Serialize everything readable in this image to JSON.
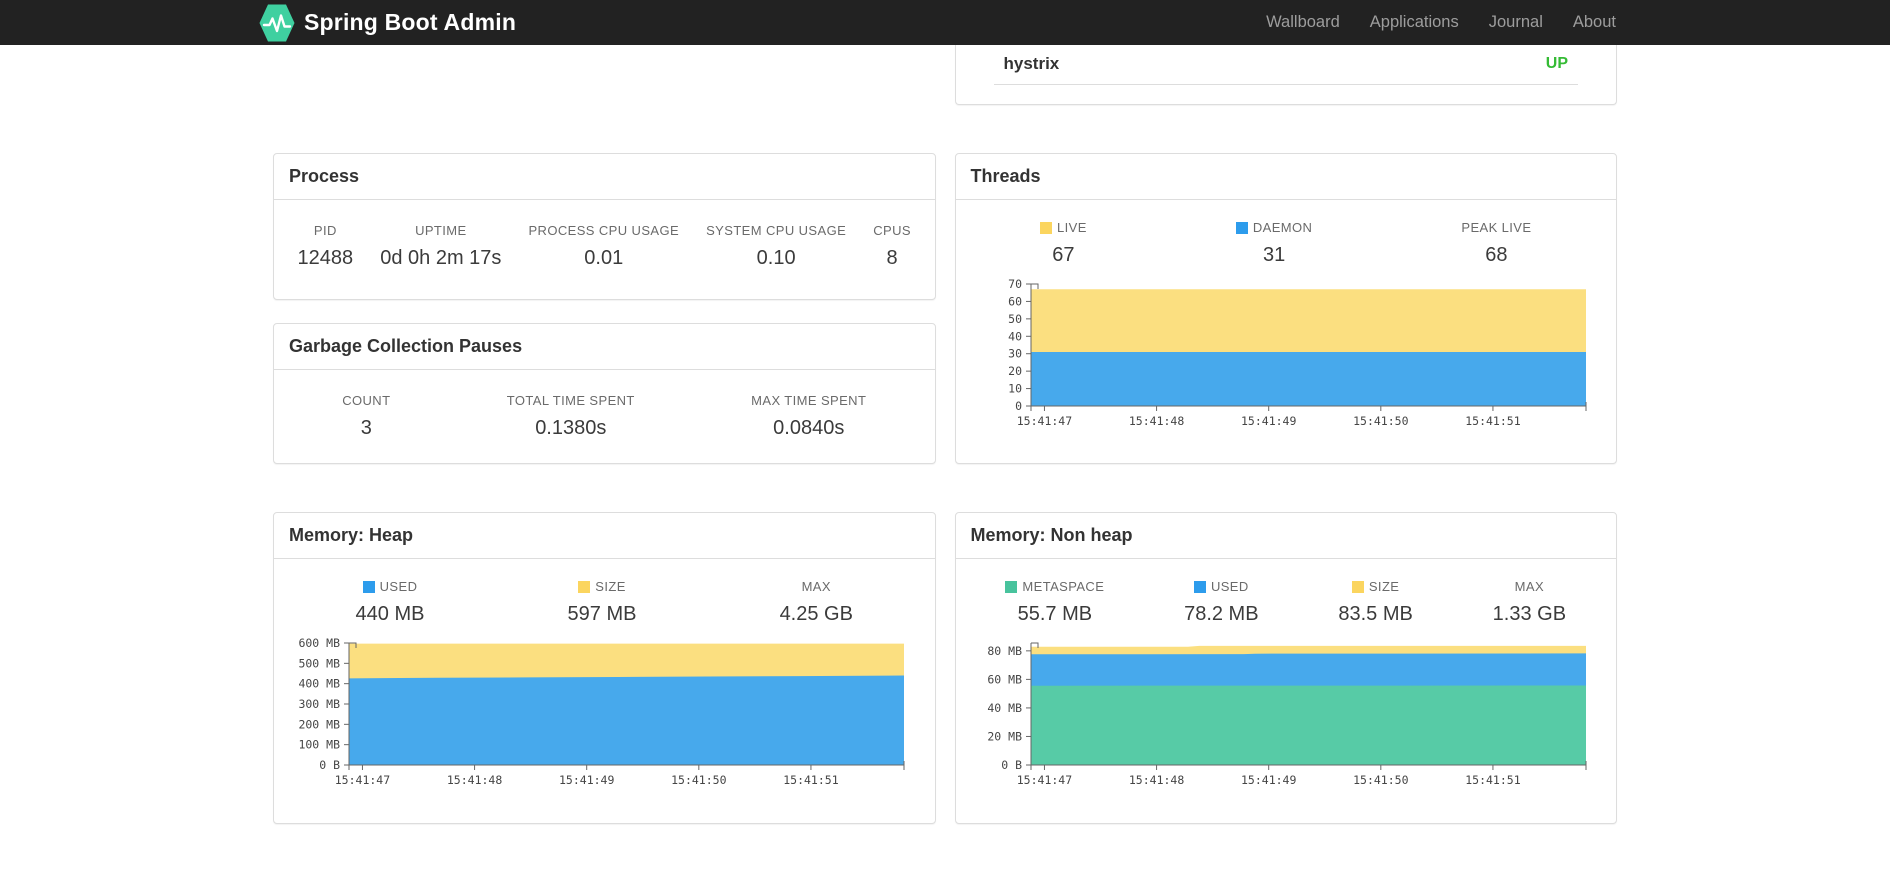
{
  "navbar": {
    "brand": "Spring Boot Admin",
    "logo_color": "#3fd0a0",
    "items": [
      {
        "label": "Wallboard"
      },
      {
        "label": "Applications"
      },
      {
        "label": "Journal"
      },
      {
        "label": "About"
      }
    ]
  },
  "status_panel": {
    "application": "hystrix",
    "status": "UP",
    "status_color": "#35bb35"
  },
  "process": {
    "title": "Process",
    "metrics": [
      {
        "label": "PID",
        "value": "12488"
      },
      {
        "label": "UPTIME",
        "value": "0d 0h 2m 17s"
      },
      {
        "label": "PROCESS CPU USAGE",
        "value": "0.01"
      },
      {
        "label": "SYSTEM CPU USAGE",
        "value": "0.10"
      },
      {
        "label": "CPUS",
        "value": "8"
      }
    ]
  },
  "gc": {
    "title": "Garbage Collection Pauses",
    "metrics": [
      {
        "label": "COUNT",
        "value": "3"
      },
      {
        "label": "TOTAL TIME SPENT",
        "value": "0.1380s"
      },
      {
        "label": "MAX TIME SPENT",
        "value": "0.0840s"
      }
    ]
  },
  "threads": {
    "title": "Threads",
    "metrics": [
      {
        "label": "LIVE",
        "value": "67",
        "swatch": "#fbd55f"
      },
      {
        "label": "DAEMON",
        "value": "31",
        "swatch": "#2d9cec"
      },
      {
        "label": "PEAK LIVE",
        "value": "68"
      }
    ]
  },
  "heap": {
    "title": "Memory: Heap",
    "metrics": [
      {
        "label": "USED",
        "value": "440 MB",
        "swatch": "#2d9cec"
      },
      {
        "label": "SIZE",
        "value": "597 MB",
        "swatch": "#fbd55f"
      },
      {
        "label": "MAX",
        "value": "4.25 GB"
      }
    ]
  },
  "nonheap": {
    "title": "Memory: Non heap",
    "metrics": [
      {
        "label": "METASPACE",
        "value": "55.7 MB",
        "swatch": "#48c39d"
      },
      {
        "label": "USED",
        "value": "78.2 MB",
        "swatch": "#2d9cec"
      },
      {
        "label": "SIZE",
        "value": "83.5 MB",
        "swatch": "#fbd55f"
      },
      {
        "label": "MAX",
        "value": "1.33 GB"
      }
    ]
  },
  "chart_data": [
    {
      "id": "threads",
      "type": "area",
      "title": "Threads",
      "x_ticks": [
        "15:41:47",
        "15:41:48",
        "15:41:49",
        "15:41:50",
        "15:41:51"
      ],
      "x_domain": [
        0,
        4.95
      ],
      "x_tick_offset": 0.12,
      "y_max": 70,
      "y_ticks": [
        {
          "v": 0,
          "label": "0"
        },
        {
          "v": 10,
          "label": "10"
        },
        {
          "v": 20,
          "label": "20"
        },
        {
          "v": 30,
          "label": "30"
        },
        {
          "v": 40,
          "label": "40"
        },
        {
          "v": 50,
          "label": "50"
        },
        {
          "v": 60,
          "label": "60"
        },
        {
          "v": 70,
          "label": "70"
        }
      ],
      "series": [
        {
          "name": "LIVE",
          "color": "#fbdf80",
          "points": [
            [
              0,
              67
            ],
            [
              4.95,
              67
            ]
          ]
        },
        {
          "name": "DAEMON",
          "color": "#47a9ec",
          "points": [
            [
              0,
              31
            ],
            [
              4.95,
              31
            ]
          ]
        }
      ],
      "legend_position": "top",
      "grid": false
    },
    {
      "id": "heap",
      "type": "area",
      "title": "Memory: Heap",
      "x_ticks": [
        "15:41:47",
        "15:41:48",
        "15:41:49",
        "15:41:50",
        "15:41:51"
      ],
      "x_domain": [
        0,
        4.95
      ],
      "x_tick_offset": 0.12,
      "y_max": 600,
      "y_unit": "MB",
      "y_ticks": [
        {
          "v": 0,
          "label": "0 B"
        },
        {
          "v": 100,
          "label": "100 MB"
        },
        {
          "v": 200,
          "label": "200 MB"
        },
        {
          "v": 300,
          "label": "300 MB"
        },
        {
          "v": 400,
          "label": "400 MB"
        },
        {
          "v": 500,
          "label": "500 MB"
        },
        {
          "v": 600,
          "label": "600 MB"
        }
      ],
      "series": [
        {
          "name": "SIZE",
          "color": "#fbdf80",
          "points": [
            [
              0,
              597
            ],
            [
              4.95,
              597
            ]
          ]
        },
        {
          "name": "USED",
          "color": "#47a9ec",
          "points": [
            [
              0,
              426
            ],
            [
              0.8,
              429
            ],
            [
              1.6,
              431
            ],
            [
              2.4,
              433
            ],
            [
              3.2,
              435
            ],
            [
              4.0,
              437
            ],
            [
              4.95,
              440
            ]
          ]
        }
      ],
      "legend_position": "top",
      "grid": false
    },
    {
      "id": "nonheap",
      "type": "area",
      "title": "Memory: Non heap",
      "x_ticks": [
        "15:41:47",
        "15:41:48",
        "15:41:49",
        "15:41:50",
        "15:41:51"
      ],
      "x_domain": [
        0,
        4.95
      ],
      "x_tick_offset": 0.12,
      "y_max": 85.5,
      "y_unit": "MB",
      "y_ticks": [
        {
          "v": 0,
          "label": "0 B"
        },
        {
          "v": 20,
          "label": "20 MB"
        },
        {
          "v": 40,
          "label": "40 MB"
        },
        {
          "v": 60,
          "label": "60 MB"
        },
        {
          "v": 80,
          "label": "80 MB"
        }
      ],
      "series": [
        {
          "name": "SIZE",
          "color": "#fbdf80",
          "points": [
            [
              0,
              82.9
            ],
            [
              1.4,
              82.9
            ],
            [
              1.5,
              83.5
            ],
            [
              4.95,
              83.5
            ]
          ]
        },
        {
          "name": "USED",
          "color": "#47a9ec",
          "points": [
            [
              0,
              77.6
            ],
            [
              1.9,
              77.7
            ],
            [
              2.0,
              78.0
            ],
            [
              4.95,
              78.2
            ]
          ]
        },
        {
          "name": "METASPACE",
          "color": "#57cba6",
          "points": [
            [
              0,
              55.6
            ],
            [
              4.95,
              55.7
            ]
          ]
        }
      ],
      "legend_position": "top",
      "grid": false
    }
  ]
}
